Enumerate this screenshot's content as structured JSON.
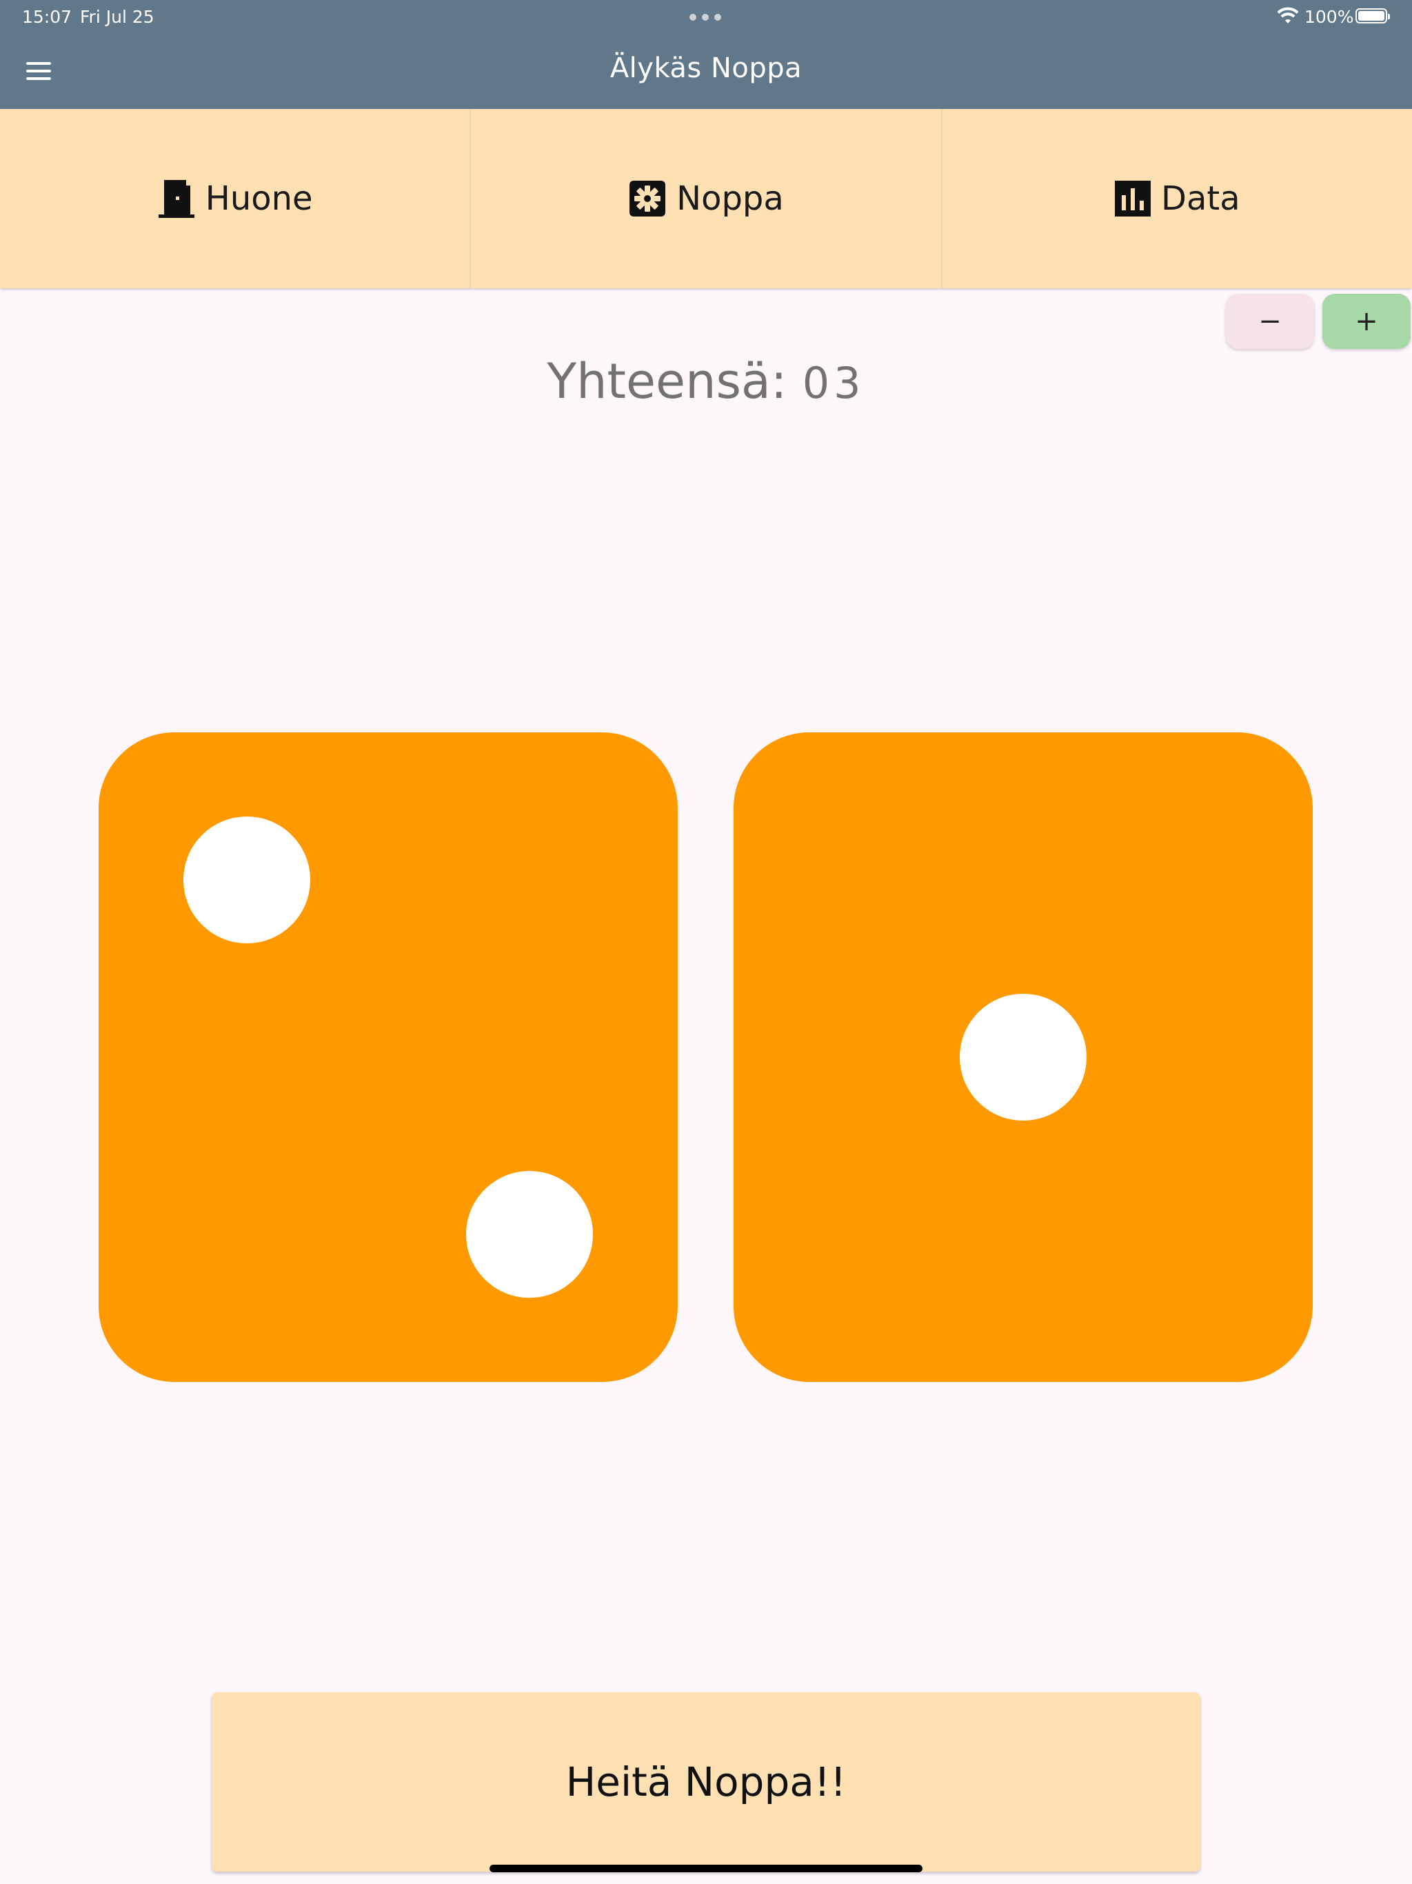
{
  "status_bar": {
    "time": "15:07",
    "date": "Fri Jul 25",
    "battery": "100%",
    "icons": [
      "wifi-icon",
      "battery-icon",
      "multitask-dots-icon"
    ]
  },
  "app_bar": {
    "title": "Älykäs Noppa",
    "menu_icon": "hamburger-menu-icon",
    "background": "#607889"
  },
  "tabs": [
    {
      "label": "Huone",
      "icon": "door-icon"
    },
    {
      "label": "Noppa",
      "icon": "settings-gear-icon"
    },
    {
      "label": "Data",
      "icon": "bar-chart-icon"
    }
  ],
  "stepper": {
    "minus_label": "−",
    "plus_label": "+"
  },
  "total": {
    "label": "Yhteensä:",
    "value": "03"
  },
  "dice": {
    "values": [
      2,
      1
    ],
    "color": "#ff9900",
    "pip_color": "#ffffff"
  },
  "roll_button": {
    "label": "Heitä Noppa!!"
  },
  "colors": {
    "tab_background": "#fee0b3",
    "page_background": "#fdf7fc",
    "plus_button": "#a6d9a7",
    "minus_button": "#f6e3ea"
  }
}
